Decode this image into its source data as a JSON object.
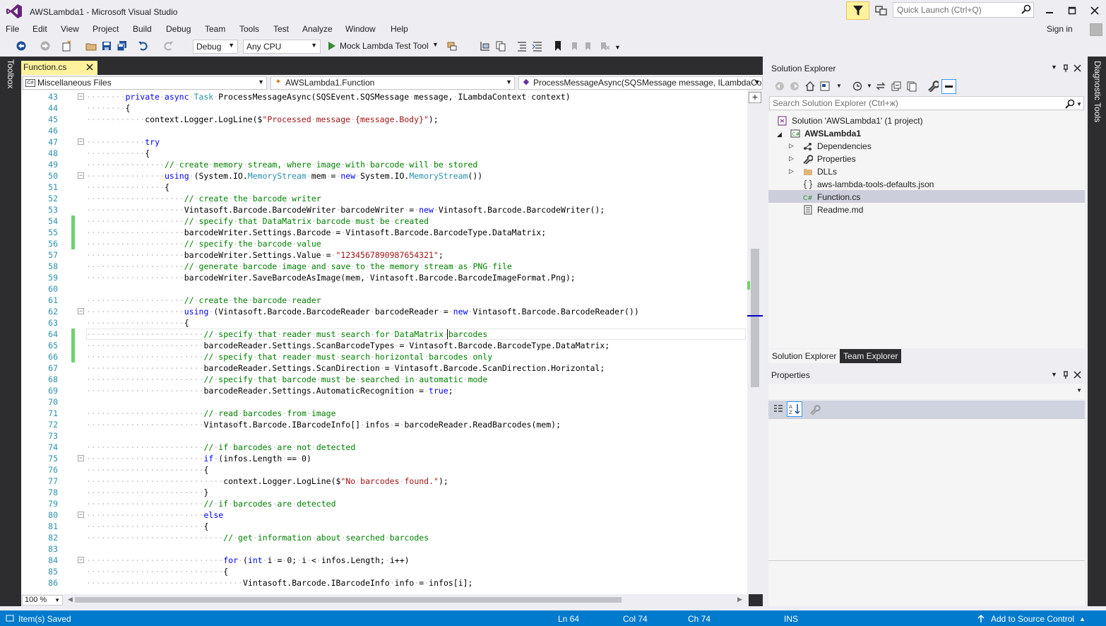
{
  "window": {
    "title": "AWSLambda1 - Microsoft Visual Studio",
    "quick_launch_placeholder": "Quick Launch (Ctrl+Q)",
    "sign_in": "Sign in"
  },
  "menu": [
    "File",
    "Edit",
    "View",
    "Project",
    "Build",
    "Debug",
    "Team",
    "Tools",
    "Test",
    "Analyze",
    "Window",
    "Help"
  ],
  "toolbar": {
    "configuration": "Debug",
    "platform": "Any CPU",
    "run_label": "Mock Lambda Test Tool"
  },
  "side_tabs": {
    "left": "Toolbox",
    "right": "Diagnostic Tools"
  },
  "editor": {
    "tab_label": "Function.cs",
    "nav_project": "Miscellaneous Files",
    "nav_type": "AWSLambda1.Function",
    "nav_member": "ProcessMessageAsync(SQSMessage message, ILambdaCon",
    "zoom": "100 %",
    "lines": [
      {
        "n": "43",
        "t": "        private async Task ProcessMessageAsync(SQSEvent.SQSMessage message, ILambdaContext context)"
      },
      {
        "n": "44",
        "t": "        {"
      },
      {
        "n": "45",
        "t": "            context.Logger.LogLine($\"Processed message {message.Body}\");"
      },
      {
        "n": "46",
        "t": ""
      },
      {
        "n": "47",
        "t": "            try"
      },
      {
        "n": "48",
        "t": "            {"
      },
      {
        "n": "49",
        "t": "                // create memory stream, where image with barcode will be stored"
      },
      {
        "n": "50",
        "t": "                using (System.IO.MemoryStream mem = new System.IO.MemoryStream())"
      },
      {
        "n": "51",
        "t": "                {"
      },
      {
        "n": "52",
        "t": "                    // create the barcode writer"
      },
      {
        "n": "53",
        "t": "                    Vintasoft.Barcode.BarcodeWriter barcodeWriter = new Vintasoft.Barcode.BarcodeWriter();"
      },
      {
        "n": "54",
        "t": "                    // specify that DataMatrix barcode must be created"
      },
      {
        "n": "55",
        "t": "                    barcodeWriter.Settings.Barcode = Vintasoft.Barcode.BarcodeType.DataMatrix;"
      },
      {
        "n": "56",
        "t": "                    // specify the barcode value"
      },
      {
        "n": "57",
        "t": "                    barcodeWriter.Settings.Value = \"1234567890987654321\";"
      },
      {
        "n": "58",
        "t": "                    // generate barcode image and save to the memory stream as PNG file"
      },
      {
        "n": "59",
        "t": "                    barcodeWriter.SaveBarcodeAsImage(mem, Vintasoft.Barcode.BarcodeImageFormat.Png);"
      },
      {
        "n": "60",
        "t": ""
      },
      {
        "n": "61",
        "t": "                    // create the barcode reader"
      },
      {
        "n": "62",
        "t": "                    using (Vintasoft.Barcode.BarcodeReader barcodeReader = new Vintasoft.Barcode.BarcodeReader())"
      },
      {
        "n": "63",
        "t": "                    {"
      },
      {
        "n": "64",
        "t": "                        // specify that reader must search for DataMatrix barcodes"
      },
      {
        "n": "65",
        "t": "                        barcodeReader.Settings.ScanBarcodeTypes = Vintasoft.Barcode.BarcodeType.DataMatrix;"
      },
      {
        "n": "66",
        "t": "                        // specify that reader must search horizontal barcodes only"
      },
      {
        "n": "67",
        "t": "                        barcodeReader.Settings.ScanDirection = Vintasoft.Barcode.ScanDirection.Horizontal;"
      },
      {
        "n": "68",
        "t": "                        // specify that barcode must be searched in automatic mode"
      },
      {
        "n": "69",
        "t": "                        barcodeReader.Settings.AutomaticRecognition = true;"
      },
      {
        "n": "70",
        "t": ""
      },
      {
        "n": "71",
        "t": "                        // read barcodes from image"
      },
      {
        "n": "72",
        "t": "                        Vintasoft.Barcode.IBarcodeInfo[] infos = barcodeReader.ReadBarcodes(mem);"
      },
      {
        "n": "73",
        "t": ""
      },
      {
        "n": "74",
        "t": "                        // if barcodes are not detected"
      },
      {
        "n": "75",
        "t": "                        if (infos.Length == 0)"
      },
      {
        "n": "76",
        "t": "                        {"
      },
      {
        "n": "77",
        "t": "                            context.Logger.LogLine($\"No barcodes found.\");"
      },
      {
        "n": "78",
        "t": "                        }"
      },
      {
        "n": "79",
        "t": "                        // if barcodes are detected"
      },
      {
        "n": "80",
        "t": "                        else"
      },
      {
        "n": "81",
        "t": "                        {"
      },
      {
        "n": "82",
        "t": "                            // get information about searched barcodes"
      },
      {
        "n": "83",
        "t": ""
      },
      {
        "n": "84",
        "t": "                            for (int i = 0; i < infos.Length; i++)"
      },
      {
        "n": "85",
        "t": "                            {"
      },
      {
        "n": "86",
        "t": "                                Vintasoft.Barcode.IBarcodeInfo info = infos[i];"
      }
    ]
  },
  "solution_explorer": {
    "title": "Solution Explorer",
    "search_placeholder": "Search Solution Explorer (Ctrl+ж)",
    "items": [
      {
        "label": "Solution 'AWSLambda1' (1 project)"
      },
      {
        "label": "AWSLambda1"
      },
      {
        "label": "Dependencies"
      },
      {
        "label": "Properties"
      },
      {
        "label": "DLLs"
      },
      {
        "label": "aws-lambda-tools-defaults.json"
      },
      {
        "label": "Function.cs"
      },
      {
        "label": "Readme.md"
      }
    ],
    "tabs": [
      "Solution Explorer",
      "Team Explorer"
    ]
  },
  "properties": {
    "title": "Properties"
  },
  "status": {
    "message": "Item(s) Saved",
    "ln": "Ln 64",
    "col": "Col 74",
    "ch": "Ch 74",
    "mode": "INS",
    "source_control": "Add to Source Control"
  },
  "colors": {
    "accent": "#007acc",
    "keyword": "#0000ff",
    "type": "#2b91af",
    "string": "#a31515",
    "comment": "#008000",
    "tab_active": "#fff29d"
  }
}
